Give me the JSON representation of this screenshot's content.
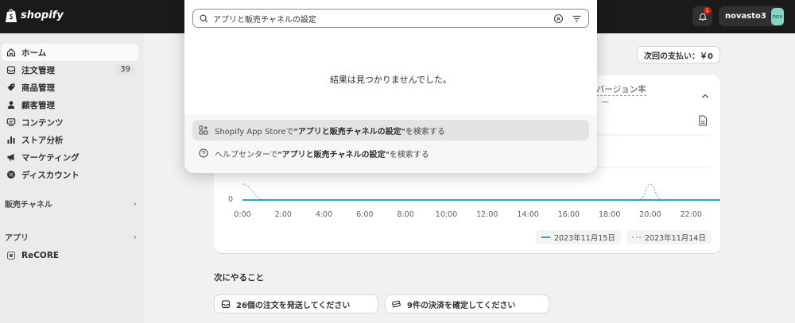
{
  "topbar": {
    "brand": "shopify",
    "notification_count": "1",
    "store_name": "novasto3",
    "store_avatar": "nov"
  },
  "sidebar": {
    "items": [
      {
        "label": "ホーム",
        "icon": "home-icon",
        "active": true
      },
      {
        "label": "注文管理",
        "icon": "inbox-icon",
        "count": "39"
      },
      {
        "label": "商品管理",
        "icon": "tag-icon"
      },
      {
        "label": "顧客管理",
        "icon": "person-icon"
      },
      {
        "label": "コンテンツ",
        "icon": "content-icon"
      },
      {
        "label": "ストア分析",
        "icon": "bar-chart-icon"
      },
      {
        "label": "マーケティング",
        "icon": "megaphone-icon"
      },
      {
        "label": "ディスカウント",
        "icon": "discount-icon"
      }
    ],
    "sales_channels": "販売チャネル",
    "apps": "アプリ",
    "app_items": [
      {
        "label": "ReCORE",
        "icon": "app-icon"
      }
    ]
  },
  "main": {
    "payment_button": "次回の支払い：￥0",
    "card": {
      "conversion_label": "バージョン率",
      "conversion_value": "—",
      "y_zero": "0"
    },
    "todo_title": "次にやること",
    "todos": [
      {
        "label": "26個の注文を発送してください",
        "icon": "inbox-icon"
      },
      {
        "label": "9件の決済を確定してください",
        "icon": "credit-card-icon"
      }
    ]
  },
  "chart_data": {
    "type": "line",
    "x": [
      "0:00",
      "2:00",
      "4:00",
      "6:00",
      "8:00",
      "10:00",
      "12:00",
      "14:00",
      "16:00",
      "18:00",
      "20:00",
      "22:00"
    ],
    "series": [
      {
        "name": "2023年11月15日",
        "style": "solid",
        "color": "#2fa0d2"
      },
      {
        "name": "2023年11月14日",
        "style": "dotted",
        "color": "#8ac8e8"
      }
    ],
    "y_tick_labels": [
      "0"
    ]
  },
  "search": {
    "query": "アプリと販売チャネルの設定",
    "no_results": "結果は見つかりませんでした。",
    "suggestions": [
      {
        "prefix": "Shopify App Storeで",
        "query": "\"アプリと販売チャネルの設定\"",
        "suffix": "を検索する",
        "icon": "apps-grid-icon"
      },
      {
        "prefix": "ヘルプセンターで",
        "query": "\"アプリと販売チャネルの設定\"",
        "suffix": "を検索する",
        "icon": "help-circle-icon"
      }
    ]
  }
}
